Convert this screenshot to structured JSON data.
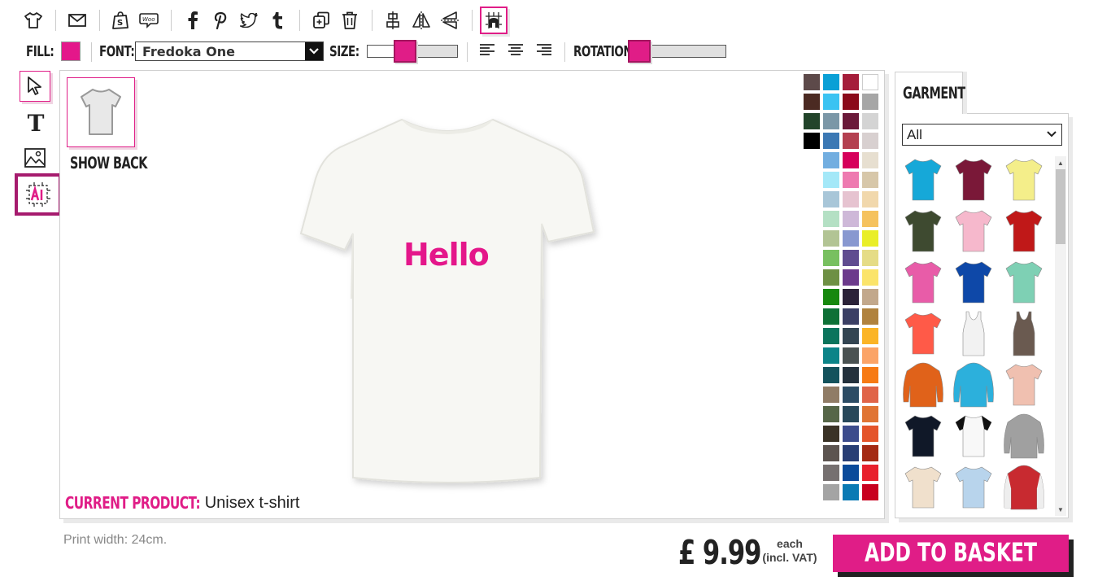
{
  "toolbar": {
    "icons": [
      "tshirt-icon",
      "envelope-icon",
      "shopify-icon",
      "woo-icon",
      "facebook-icon",
      "pinterest-icon",
      "twitter-icon",
      "tumblr-icon",
      "duplicate-icon",
      "trash-icon",
      "align-center-icon",
      "flip-horizontal-icon",
      "flip-vertical-icon",
      "grid-snap-icon"
    ],
    "fill_label": "FILL:",
    "fill_color": "#e4178a",
    "font_label": "FONT:",
    "font_value": "Fredoka One",
    "size_label": "SIZE:",
    "rotation_label": "ROTATION:"
  },
  "sidebar": {
    "tools": [
      "select-tool",
      "text-tool",
      "image-tool",
      "ai-tool"
    ]
  },
  "canvas": {
    "show_back_label": "SHOW BACK",
    "design_text": "Hello",
    "current_product_label": "CURRENT PRODUCT:",
    "current_product_value": "Unisex t-shirt"
  },
  "palette": [
    [
      "#5d4a4a",
      "#0aa0d6",
      "#a51d3a",
      "#ffffff"
    ],
    [
      "#4b2a22",
      "#3bc3f2",
      "#8b0a1a",
      "#a6a6a6"
    ],
    [
      "#22442a",
      "#7b97a7",
      "#6b1a3a",
      "#d4d4d4"
    ],
    [
      "#000000",
      "#3b78b4",
      "#b44050",
      "#d8d0d0"
    ],
    [
      null,
      "#72aee0",
      "#d6005a",
      "#e7dfd0"
    ],
    [
      null,
      "#a4e8f8",
      "#ee7ab0",
      "#d7c7a9"
    ],
    [
      null,
      "#a8c6d8",
      "#e6c3d0",
      "#f1d8ac"
    ],
    [
      null,
      "#b4e0c4",
      "#ceb8d8",
      "#f5c25e"
    ],
    [
      null,
      "#b2c494",
      "#8898d0",
      "#e9ee28"
    ],
    [
      null,
      "#78c060",
      "#604c90",
      "#e5dc86"
    ],
    [
      null,
      "#6e9044",
      "#6c3a8c",
      "#fbe46a"
    ],
    [
      null,
      "#17880e",
      "#2b2238",
      "#c2a88c"
    ],
    [
      null,
      "#0e7036",
      "#3b3f64",
      "#b0823e"
    ],
    [
      null,
      "#0b745c",
      "#334552",
      "#fbb426"
    ],
    [
      null,
      "#0c8488",
      "#4a5252",
      "#fba467"
    ],
    [
      null,
      "#14525c",
      "#24313c",
      "#f77a14"
    ],
    [
      null,
      "#907c66",
      "#2c4c64",
      "#e06448"
    ],
    [
      null,
      "#566648",
      "#28485a",
      "#e07434"
    ],
    [
      null,
      "#3a3226",
      "#3c4c8c",
      "#e4542a"
    ],
    [
      null,
      "#5c5450",
      "#283e74",
      "#a42a14"
    ],
    [
      null,
      "#767070",
      "#0a4a9a",
      "#e8202c"
    ],
    [
      null,
      "#a4a4a4",
      "#0a7ab4",
      "#c8001e"
    ]
  ],
  "garment": {
    "tab_label": "GARMENT",
    "filter_value": "All",
    "items": [
      {
        "name": "tshirt",
        "color": "#16a8d8"
      },
      {
        "name": "tshirt",
        "color": "#7a1838"
      },
      {
        "name": "tshirt",
        "color": "#f4ee8a"
      },
      {
        "name": "tshirt",
        "color": "#3e4a30"
      },
      {
        "name": "tshirt",
        "color": "#f6b8cc"
      },
      {
        "name": "tshirt",
        "color": "#c01818"
      },
      {
        "name": "tshirt",
        "color": "#e85ca8"
      },
      {
        "name": "tshirt",
        "color": "#0e48a8"
      },
      {
        "name": "tshirt",
        "color": "#7ed0b4"
      },
      {
        "name": "tshirt",
        "color": "#ff5a48"
      },
      {
        "name": "tank",
        "color": "#f2f2f2"
      },
      {
        "name": "tank",
        "color": "#6a5a50"
      },
      {
        "name": "hoodie",
        "color": "#e0621a"
      },
      {
        "name": "hoodie",
        "color": "#2cb0dc"
      },
      {
        "name": "tshirt",
        "color": "#f0c0b0"
      },
      {
        "name": "tshirt",
        "color": "#101828"
      },
      {
        "name": "raglan",
        "color": "#f8f8f8"
      },
      {
        "name": "hoodie",
        "color": "#a0a0a0"
      },
      {
        "name": "tshirt",
        "color": "#f0e0cc"
      },
      {
        "name": "tshirt",
        "color": "#b8d4ec"
      },
      {
        "name": "jacket",
        "color": "#c82a30"
      }
    ]
  },
  "footer": {
    "print_width": "Print width: 24cm.",
    "price": "£ 9.99",
    "each": "each",
    "vat": "(incl. VAT)",
    "add_to_basket": "ADD TO BASKET"
  },
  "colors": {
    "accent": "#e01d87",
    "dark_accent": "#a61b6e"
  }
}
